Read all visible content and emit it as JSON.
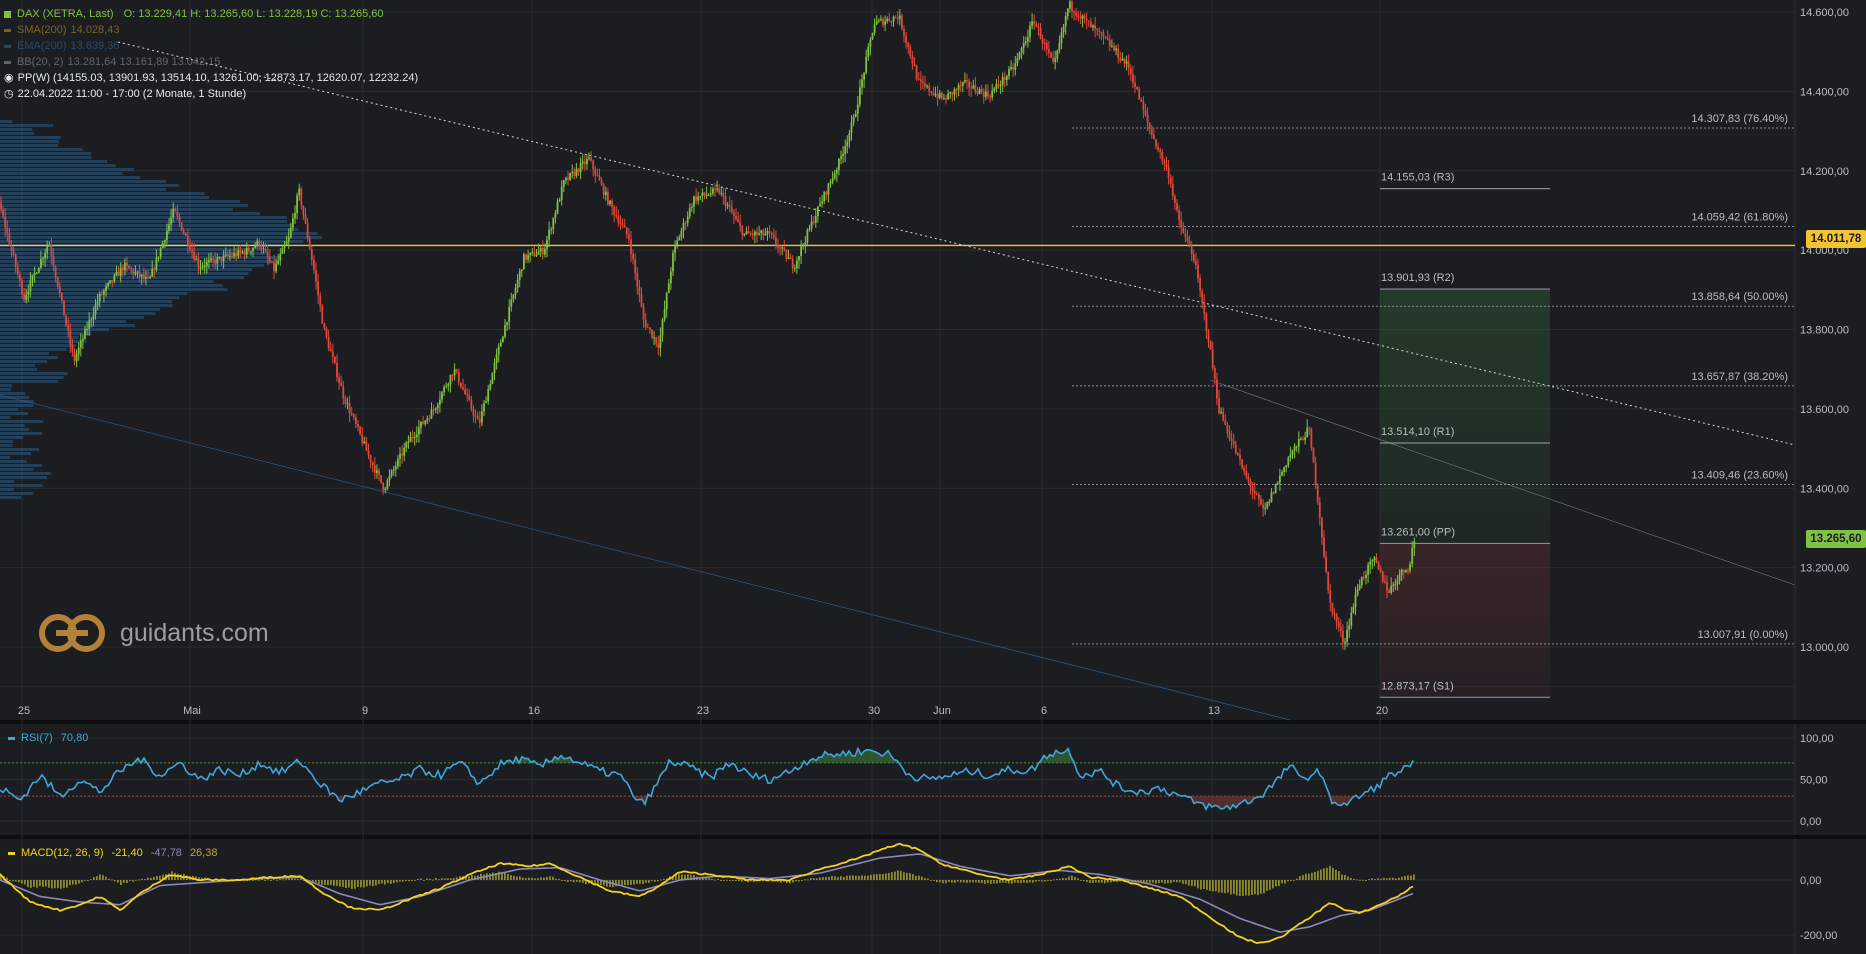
{
  "header": {
    "instrument": "DAX (XETRA, Last)",
    "ohlc": "O: 13.229,41  H: 13.265,60  L: 13.228,19  C: 13.265,60",
    "sma": "SMA(200)",
    "sma_value": "14.028,43",
    "ema": "EMA(200)",
    "ema_value": "13.639,36",
    "bb": "BB(20, 2)",
    "bb_values": "13.281,64  13.161,89  13.042,15",
    "pp": "PP(W)  (14155.03, 13901.93, 13514.10, 13261.00, 12873.17, 12620.07, 12232.24)",
    "range": "22.04.2022 11:00 - 17:00   (2 Monate, 1 Stunde)"
  },
  "brand": {
    "text": "guidants.com"
  },
  "colors": {
    "background": "#1c1d21",
    "up": "#7fc241",
    "down": "#e0483b",
    "rsi": "#3ea6d8",
    "macd": "#f2d21f",
    "signal": "#8d88b8",
    "hist": "#8f8a2a",
    "yellow_line": "#f2c432",
    "volume_profile": "#2c5b86"
  },
  "price_tags": {
    "yellow": "14.011,78",
    "green": "13.265,60"
  },
  "fibonacci": [
    {
      "value": 14307.83,
      "label": "14.307,83 (76.40%)"
    },
    {
      "value": 14059.42,
      "label": "14.059,42 (61.80%)"
    },
    {
      "value": 13858.64,
      "label": "13.858,64 (50.00%)"
    },
    {
      "value": 13657.87,
      "label": "13.657,87 (38.20%)"
    },
    {
      "value": 13409.46,
      "label": "13.409,46 (23.60%)"
    },
    {
      "value": 13007.91,
      "label": "13.007,91 (0.00%)"
    }
  ],
  "pivots": [
    {
      "value": 14155.03,
      "label": "14.155,03 (R3)"
    },
    {
      "value": 13901.93,
      "label": "13.901,93 (R2)"
    },
    {
      "value": 13514.1,
      "label": "13.514,10 (R1)"
    },
    {
      "value": 13261.0,
      "label": "13.261,00 (PP)"
    },
    {
      "value": 12873.17,
      "label": "12.873,17 (S1)"
    }
  ],
  "rsi": {
    "label": "RSI(7)",
    "value": "70,80"
  },
  "macd": {
    "label": "MACD(12, 26, 9)",
    "value": "-21,40",
    "signal": "-47,78",
    "hist": "26,38"
  },
  "chart_data": [
    {
      "type": "candlestick",
      "title": "DAX (XETRA, Last)",
      "xlabel": "",
      "ylabel": "",
      "x_tick_labels": [
        "25",
        "Mai",
        "9",
        "16",
        "23",
        "30",
        "Jun",
        "6",
        "13",
        "20"
      ],
      "y_tick_labels": [
        "14.600,00",
        "14.400,00",
        "14.200,00",
        "14.000,00",
        "13.800,00",
        "13.600,00",
        "13.400,00",
        "13.200,00",
        "13.000,00"
      ],
      "ylim": [
        12800,
        14630
      ],
      "grid": true,
      "series": [
        {
          "anchors": [
            [
              0,
              14120
            ],
            [
              25,
              13880
            ],
            [
              50,
              14020
            ],
            [
              75,
              13720
            ],
            [
              100,
              13880
            ],
            [
              125,
              13960
            ],
            [
              150,
              13920
            ],
            [
              175,
              14100
            ],
            [
              200,
              13960
            ],
            [
              225,
              13980
            ],
            [
              250,
              14000
            ],
            [
              260,
              14020
            ],
            [
              275,
              13950
            ],
            [
              290,
              14030
            ],
            [
              300,
              14150
            ],
            [
              315,
              13950
            ],
            [
              325,
              13800
            ],
            [
              345,
              13630
            ],
            [
              370,
              13480
            ],
            [
              385,
              13400
            ],
            [
              410,
              13520
            ],
            [
              435,
              13600
            ],
            [
              455,
              13700
            ],
            [
              480,
              13560
            ],
            [
              505,
              13800
            ],
            [
              525,
              13980
            ],
            [
              545,
              14000
            ],
            [
              565,
              14170
            ],
            [
              590,
              14230
            ],
            [
              610,
              14120
            ],
            [
              630,
              14030
            ],
            [
              645,
              13820
            ],
            [
              660,
              13760
            ],
            [
              675,
              14000
            ],
            [
              695,
              14130
            ],
            [
              720,
              14150
            ],
            [
              745,
              14040
            ],
            [
              770,
              14040
            ],
            [
              795,
              13960
            ],
            [
              815,
              14080
            ],
            [
              840,
              14220
            ],
            [
              855,
              14330
            ],
            [
              875,
              14570
            ],
            [
              900,
              14590
            ],
            [
              920,
              14420
            ],
            [
              945,
              14380
            ],
            [
              965,
              14420
            ],
            [
              990,
              14390
            ],
            [
              1015,
              14460
            ],
            [
              1035,
              14580
            ],
            [
              1055,
              14460
            ],
            [
              1070,
              14620
            ],
            [
              1085,
              14580
            ],
            [
              1110,
              14520
            ],
            [
              1130,
              14460
            ],
            [
              1150,
              14310
            ],
            [
              1170,
              14190
            ],
            [
              1180,
              14070
            ],
            [
              1195,
              13980
            ],
            [
              1210,
              13770
            ],
            [
              1220,
              13600
            ],
            [
              1245,
              13440
            ],
            [
              1265,
              13340
            ],
            [
              1290,
              13480
            ],
            [
              1310,
              13550
            ],
            [
              1320,
              13350
            ],
            [
              1330,
              13120
            ],
            [
              1345,
              13010
            ],
            [
              1360,
              13160
            ],
            [
              1375,
              13220
            ],
            [
              1390,
              13140
            ],
            [
              1400,
              13180
            ],
            [
              1412,
              13210
            ],
            [
              1414,
              13265.6
            ]
          ]
        }
      ],
      "volume_profile_peak_price": 14011.78
    },
    {
      "type": "line",
      "title": "RSI(7)",
      "y_tick_labels": [
        "100,00",
        "50,00",
        "0,00"
      ],
      "ylim": [
        0,
        100
      ],
      "thresholds": [
        70,
        30
      ],
      "series": [
        {
          "name": "RSI(7)",
          "anchors": [
            [
              0,
              40
            ],
            [
              20,
              25
            ],
            [
              40,
              55
            ],
            [
              60,
              30
            ],
            [
              80,
              50
            ],
            [
              100,
              35
            ],
            [
              120,
              60
            ],
            [
              140,
              75
            ],
            [
              160,
              55
            ],
            [
              180,
              70
            ],
            [
              200,
              50
            ],
            [
              220,
              62
            ],
            [
              240,
              55
            ],
            [
              260,
              70
            ],
            [
              280,
              58
            ],
            [
              300,
              72
            ],
            [
              320,
              45
            ],
            [
              340,
              25
            ],
            [
              360,
              35
            ],
            [
              380,
              45
            ],
            [
              400,
              50
            ],
            [
              420,
              62
            ],
            [
              440,
              55
            ],
            [
              460,
              70
            ],
            [
              480,
              45
            ],
            [
              500,
              68
            ],
            [
              520,
              75
            ],
            [
              540,
              65
            ],
            [
              560,
              80
            ],
            [
              580,
              70
            ],
            [
              600,
              60
            ],
            [
              620,
              55
            ],
            [
              640,
              20
            ],
            [
              650,
              30
            ],
            [
              670,
              72
            ],
            [
              690,
              65
            ],
            [
              710,
              52
            ],
            [
              730,
              70
            ],
            [
              750,
              55
            ],
            [
              770,
              50
            ],
            [
              790,
              60
            ],
            [
              810,
              75
            ],
            [
              830,
              80
            ],
            [
              850,
              82
            ],
            [
              870,
              85
            ],
            [
              890,
              80
            ],
            [
              910,
              55
            ],
            [
              930,
              50
            ],
            [
              950,
              55
            ],
            [
              970,
              60
            ],
            [
              990,
              55
            ],
            [
              1010,
              62
            ],
            [
              1030,
              60
            ],
            [
              1050,
              82
            ],
            [
              1070,
              85
            ],
            [
              1080,
              55
            ],
            [
              1100,
              60
            ],
            [
              1120,
              40
            ],
            [
              1140,
              35
            ],
            [
              1160,
              40
            ],
            [
              1180,
              30
            ],
            [
              1200,
              20
            ],
            [
              1220,
              15
            ],
            [
              1240,
              20
            ],
            [
              1260,
              30
            ],
            [
              1280,
              52
            ],
            [
              1290,
              68
            ],
            [
              1300,
              50
            ],
            [
              1320,
              60
            ],
            [
              1330,
              25
            ],
            [
              1345,
              20
            ],
            [
              1360,
              30
            ],
            [
              1375,
              40
            ],
            [
              1390,
              55
            ],
            [
              1400,
              60
            ],
            [
              1412,
              66
            ],
            [
              1414,
              70.8
            ]
          ]
        }
      ]
    },
    {
      "type": "line",
      "title": "MACD(12, 26, 9)",
      "y_tick_labels": [
        "0,00",
        "-200,00"
      ],
      "ylim": [
        -260,
        180
      ],
      "series": [
        {
          "name": "MACD",
          "anchors": [
            [
              0,
              20
            ],
            [
              30,
              -80
            ],
            [
              60,
              -110
            ],
            [
              80,
              -90
            ],
            [
              100,
              -60
            ],
            [
              120,
              -110
            ],
            [
              140,
              -50
            ],
            [
              170,
              20
            ],
            [
              200,
              0
            ],
            [
              240,
              0
            ],
            [
              270,
              10
            ],
            [
              300,
              15
            ],
            [
              320,
              -40
            ],
            [
              350,
              -100
            ],
            [
              380,
              -110
            ],
            [
              410,
              -70
            ],
            [
              440,
              -30
            ],
            [
              470,
              20
            ],
            [
              500,
              60
            ],
            [
              530,
              50
            ],
            [
              550,
              60
            ],
            [
              580,
              10
            ],
            [
              610,
              -40
            ],
            [
              640,
              -60
            ],
            [
              660,
              -20
            ],
            [
              680,
              30
            ],
            [
              710,
              20
            ],
            [
              750,
              0
            ],
            [
              790,
              0
            ],
            [
              820,
              40
            ],
            [
              860,
              80
            ],
            [
              880,
              110
            ],
            [
              900,
              130
            ],
            [
              920,
              110
            ],
            [
              940,
              60
            ],
            [
              980,
              20
            ],
            [
              1010,
              0
            ],
            [
              1040,
              20
            ],
            [
              1070,
              50
            ],
            [
              1090,
              10
            ],
            [
              1120,
              0
            ],
            [
              1150,
              -30
            ],
            [
              1180,
              -60
            ],
            [
              1200,
              -110
            ],
            [
              1220,
              -160
            ],
            [
              1240,
              -210
            ],
            [
              1260,
              -230
            ],
            [
              1280,
              -210
            ],
            [
              1300,
              -160
            ],
            [
              1320,
              -110
            ],
            [
              1330,
              -80
            ],
            [
              1345,
              -110
            ],
            [
              1360,
              -120
            ],
            [
              1380,
              -90
            ],
            [
              1400,
              -55
            ],
            [
              1414,
              -21.4
            ]
          ]
        },
        {
          "name": "Signal",
          "anchors": [
            [
              0,
              0
            ],
            [
              40,
              -60
            ],
            [
              80,
              -80
            ],
            [
              120,
              -90
            ],
            [
              160,
              -20
            ],
            [
              200,
              -10
            ],
            [
              260,
              5
            ],
            [
              300,
              10
            ],
            [
              340,
              -50
            ],
            [
              380,
              -90
            ],
            [
              420,
              -60
            ],
            [
              470,
              0
            ],
            [
              520,
              40
            ],
            [
              560,
              45
            ],
            [
              600,
              0
            ],
            [
              640,
              -40
            ],
            [
              680,
              0
            ],
            [
              720,
              15
            ],
            [
              770,
              5
            ],
            [
              820,
              25
            ],
            [
              880,
              80
            ],
            [
              920,
              95
            ],
            [
              960,
              50
            ],
            [
              1010,
              15
            ],
            [
              1060,
              35
            ],
            [
              1100,
              20
            ],
            [
              1150,
              -15
            ],
            [
              1200,
              -70
            ],
            [
              1240,
              -140
            ],
            [
              1280,
              -190
            ],
            [
              1310,
              -170
            ],
            [
              1340,
              -130
            ],
            [
              1370,
              -110
            ],
            [
              1414,
              -47.78
            ]
          ]
        }
      ]
    }
  ]
}
